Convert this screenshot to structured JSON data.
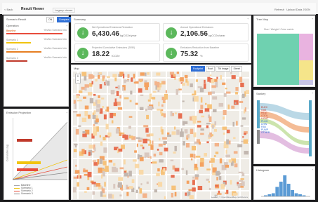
{
  "topbar": {
    "back": "< Back",
    "title": "Result Viewer",
    "legacy": "Legacy viewer",
    "refresh": "Refresh",
    "upload": "Upload Data JSON"
  },
  "left": {
    "scenario_label": "Scenario Result",
    "tab_a": "ON",
    "tab_b": "Compare",
    "section": "Operation",
    "baseline": "Baseline",
    "rows": [
      {
        "name": "Baseline",
        "note": "Yes/No Scenario Info"
      },
      {
        "name": "Scenario 1",
        "note": "Yes/No Scenario Info"
      },
      {
        "name": "Scenario 2",
        "note": "Yes/No Scenario Info"
      },
      {
        "name": "Scenario 3",
        "note": "Yes/No Scenario Info"
      }
    ],
    "projection_title": "Emission Projection",
    "proj_y": "Cumulative (kg)",
    "legend": [
      "Baseline",
      "Scenario 1",
      "Scenario 2",
      "Scenario 3"
    ]
  },
  "summary": {
    "title": "Summary",
    "cards": [
      {
        "label": "Net Operational Emissions Reduction",
        "value": "6,430.46",
        "unit": "kgCO2e/year"
      },
      {
        "label": "Annual Operational Emissions",
        "value": "2,106.56",
        "unit": "kgCO2e/year"
      },
      {
        "label": "Projected Cumulative Emissions (2050)",
        "value": "18.22",
        "unit": "tCO2e"
      },
      {
        "label": "Emissions Reduction from Baseline",
        "value": "75.32",
        "unit": "%"
      }
    ]
  },
  "map": {
    "title": "Map",
    "buttons": [
      "Footprint",
      "Roof",
      "Tilt Image",
      "Street"
    ],
    "footer": "Leaflet | © OpenStreetMap contributors"
  },
  "right": {
    "treemap_title": "Tree Map",
    "treemap_caption": "Size / Weight / Color metric",
    "treemap_colors": [
      "#6fd1b0",
      "#e9b3e0",
      "#f5e58a",
      "#c9c6e6"
    ],
    "sankey_title": "Sankey",
    "sankey_labels": [
      "ELEC",
      "GAS",
      "HEAT",
      "COOL",
      "LIGHT",
      "PLUG",
      "DHW",
      "FAN",
      "PUMP",
      "OTHER"
    ],
    "histogram_title": "Histogram",
    "hist_values": [
      1,
      2,
      3,
      9,
      14,
      20,
      12,
      6,
      3,
      2,
      1
    ]
  },
  "colors": {
    "accent": "#2f6fd6",
    "green": "#5cb85c",
    "red": "#e74c3c"
  }
}
